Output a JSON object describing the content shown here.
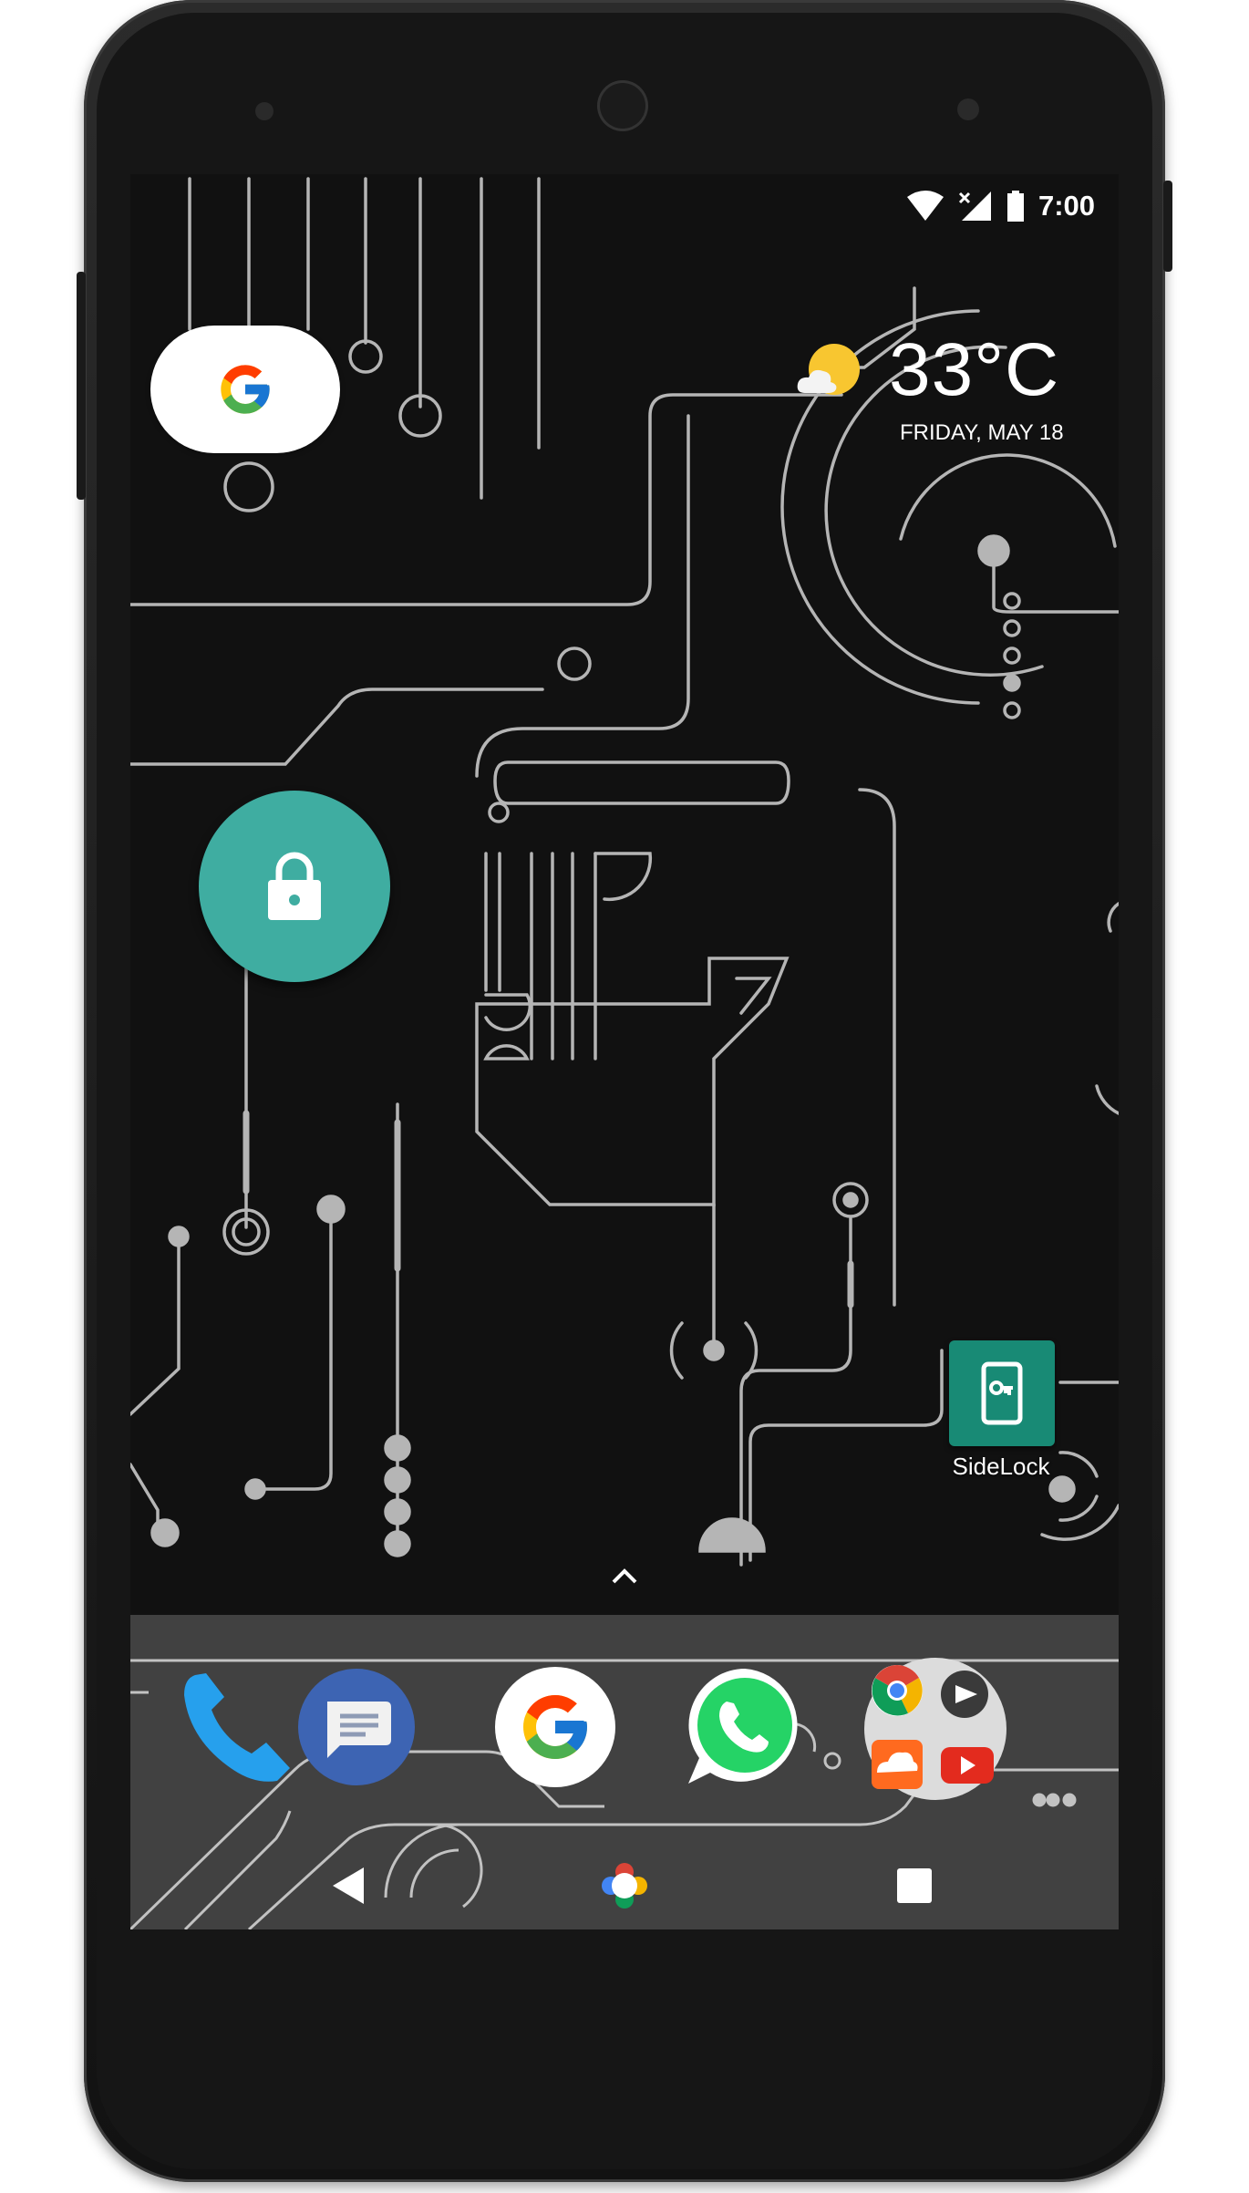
{
  "status_bar": {
    "time": "7:00"
  },
  "search_widget": {
    "icon": "google-g-icon"
  },
  "weather": {
    "icon": "partly-cloudy-icon",
    "temperature": "33°C",
    "date": "FRIDAY, MAY 18"
  },
  "lock_button": {
    "icon": "lock-icon"
  },
  "desktop_apps": [
    {
      "label": "SideLock",
      "icon": "key-phone-icon",
      "color": "#188a75"
    }
  ],
  "app_drawer": {
    "icon": "chevron-up-icon"
  },
  "dock": {
    "apps": [
      {
        "name": "Phone",
        "icon": "phone-icon"
      },
      {
        "name": "Messages",
        "icon": "messages-icon"
      },
      {
        "name": "Google",
        "icon": "google-g-icon"
      },
      {
        "name": "WhatsApp",
        "icon": "whatsapp-icon"
      },
      {
        "name": "Folder",
        "icon": "folder-icon"
      }
    ]
  },
  "nav": {
    "back": "back-icon",
    "home": "home-icon",
    "recents": "recents-icon"
  },
  "colors": {
    "accent_teal": "#3fada1",
    "sidelock_green": "#188a75",
    "wallpaper": "#111111",
    "circuit": "#b5b5b5"
  }
}
